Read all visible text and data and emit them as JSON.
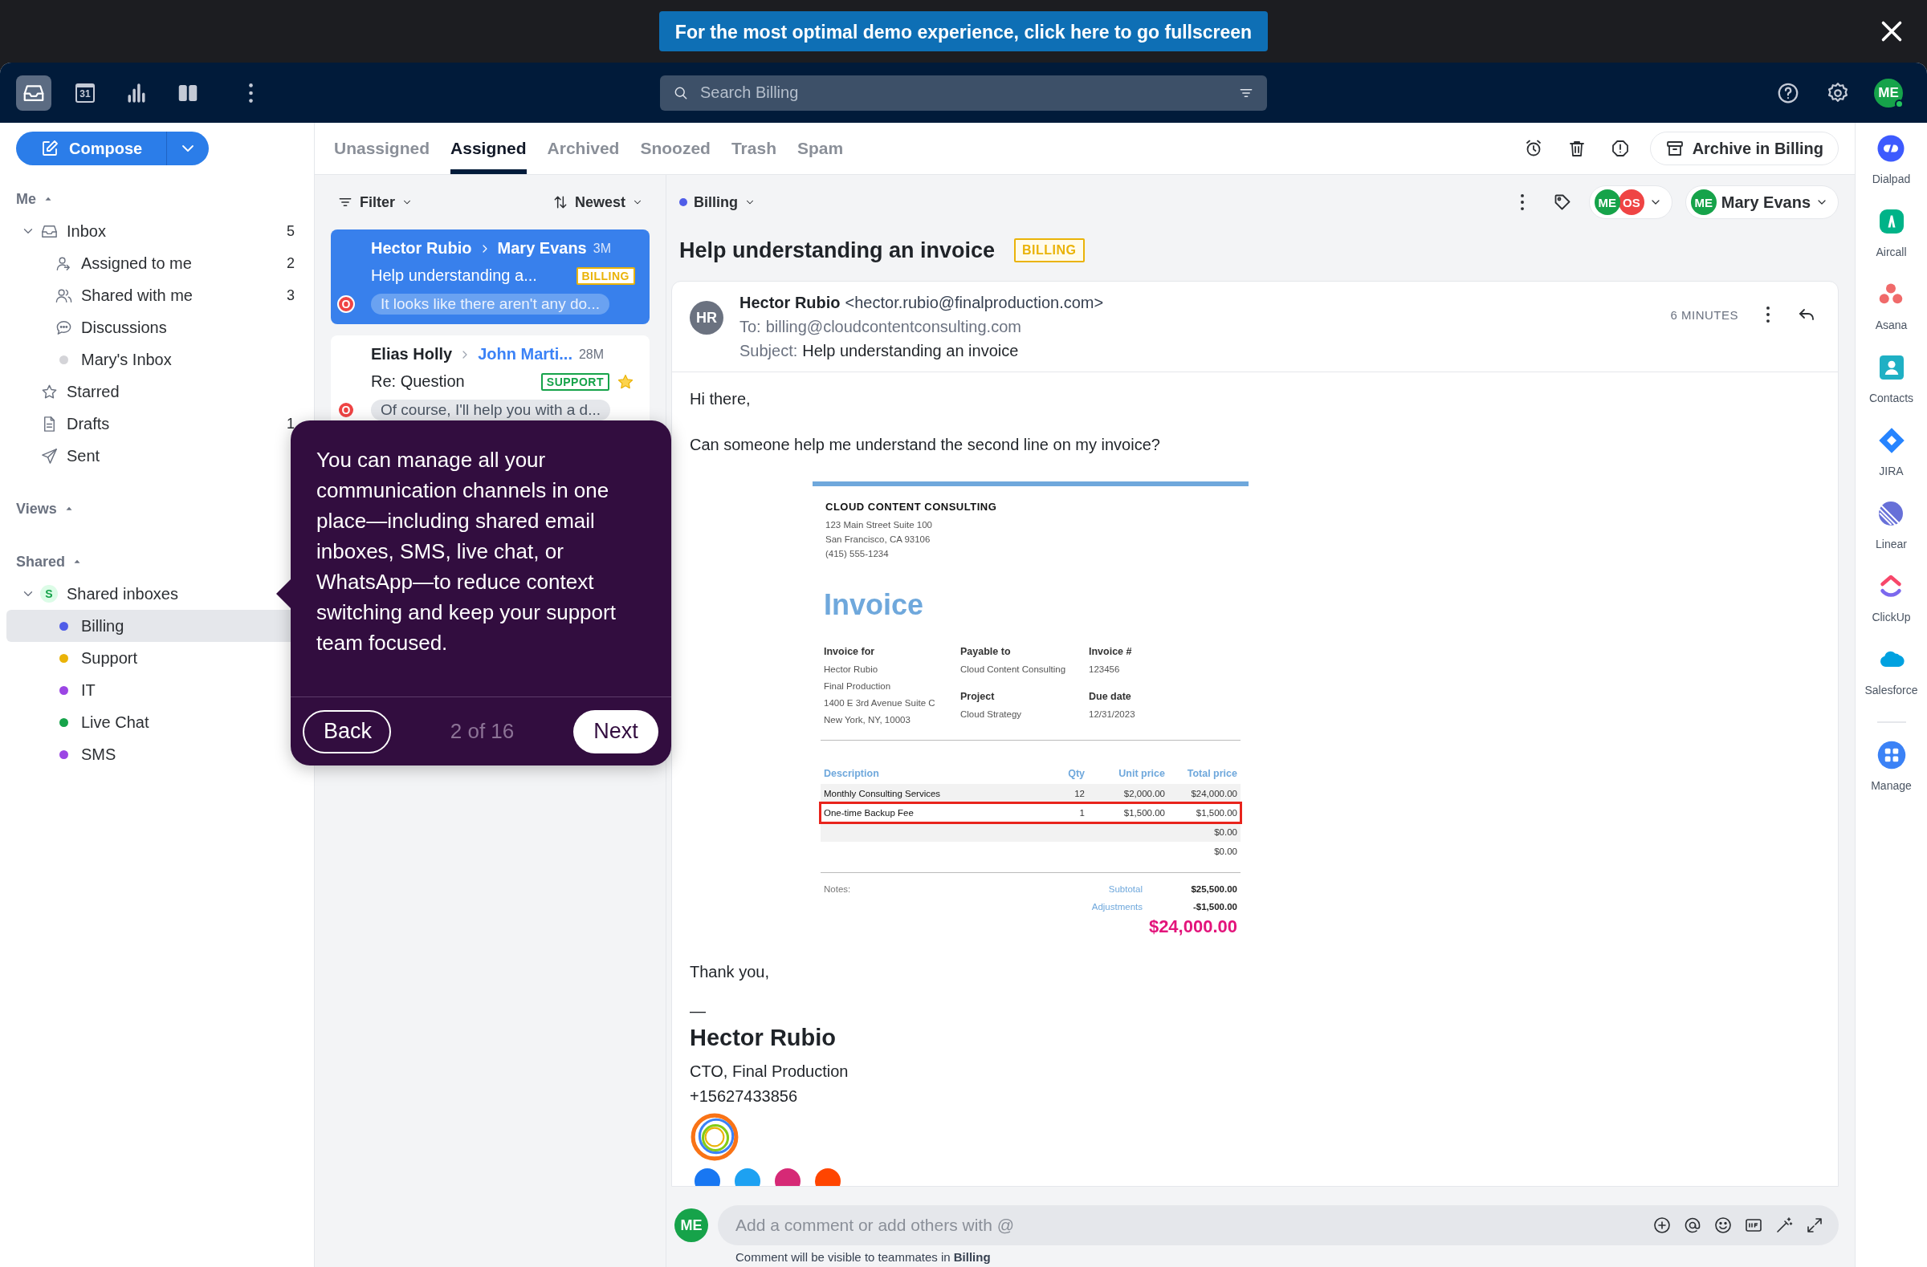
{
  "banner": {
    "text": "For the most optimal demo experience, click here to go fullscreen"
  },
  "app_bar": {
    "nav": [
      {
        "kind": "inbox",
        "selected": true
      },
      {
        "kind": "calendar",
        "label": "31",
        "selected": false
      },
      {
        "kind": "analytics",
        "selected": false
      },
      {
        "kind": "split",
        "selected": false
      },
      {
        "kind": "more",
        "selected": false
      }
    ],
    "search": {
      "placeholder": "Search Billing"
    },
    "avatar": {
      "initials": "ME",
      "color": "#16a34a"
    }
  },
  "sidebar": {
    "compose": "Compose",
    "sections": [
      {
        "title": "Me",
        "expanded": true,
        "items": [
          {
            "label": "Inbox",
            "kind": "inbox",
            "count": "5",
            "selected": false,
            "expanded": true,
            "children": [
              {
                "label": "Assigned to me",
                "kind": "assigned",
                "count": "2",
                "selected": false
              },
              {
                "label": "Shared with me",
                "kind": "shared",
                "count": "3",
                "selected": false
              },
              {
                "label": "Discussions",
                "kind": "discussions",
                "selected": false
              },
              {
                "label": "Mary's Inbox",
                "kind": "dot",
                "color": "#d4d4d8",
                "selected": false
              }
            ]
          },
          {
            "label": "Starred",
            "kind": "star",
            "selected": false
          },
          {
            "label": "Drafts",
            "kind": "draft",
            "count": "1",
            "selected": false
          },
          {
            "label": "Sent",
            "kind": "sent",
            "selected": false
          }
        ]
      },
      {
        "title": "Views",
        "expanded": true
      },
      {
        "title": "Shared",
        "expanded": true,
        "items": [
          {
            "label": "Shared inboxes",
            "kind": "team",
            "badge": "S",
            "selected": false,
            "expanded": true,
            "children": [
              {
                "label": "Billing",
                "kind": "dot",
                "color": "#4f5de8",
                "selected": true
              },
              {
                "label": "Support",
                "kind": "dot",
                "color": "#eab308",
                "selected": false
              },
              {
                "label": "IT",
                "kind": "dot",
                "color": "#9b45e4",
                "selected": false
              },
              {
                "label": "Live Chat",
                "kind": "dot",
                "color": "#16a34a",
                "selected": false
              },
              {
                "label": "SMS",
                "kind": "dot",
                "color": "#9b45e4",
                "selected": false
              }
            ]
          }
        ]
      }
    ]
  },
  "tabs": [
    {
      "label": "Unassigned",
      "selected": false
    },
    {
      "label": "Assigned",
      "selected": true
    },
    {
      "label": "Archived",
      "selected": false
    },
    {
      "label": "Snoozed",
      "selected": false
    },
    {
      "label": "Trash",
      "selected": false
    },
    {
      "label": "Spam",
      "selected": false
    }
  ],
  "toolbar": {
    "archive_button": "Archive in Billing"
  },
  "list": {
    "filter": "Filter",
    "sort": "Newest",
    "conversations": [
      {
        "from": "Hector Rubio",
        "to": "Mary Evans",
        "time": "3M",
        "subject": "Help understanding a...",
        "tag": "BILLING",
        "color": "#eab308",
        "badge": "O",
        "preview": "It looks like there aren't any do...",
        "selected": true,
        "starred": false
      },
      {
        "from": "Elias Holly",
        "to": "John Marti...",
        "time": "28M",
        "subject": "Re: Question",
        "tag": "SUPPORT",
        "color": "#16a34a",
        "badge": "O",
        "preview": "Of course, I'll help you with a d...",
        "selected": false,
        "starred": true
      }
    ]
  },
  "conversation": {
    "inbox": {
      "label": "Billing",
      "color": "#4f5de8"
    },
    "participants": [
      {
        "initials": "ME",
        "color": "#16a34a"
      },
      {
        "initials": "OS",
        "color": "#ef4444"
      }
    ],
    "assignee": {
      "initials": "ME",
      "name": "Mary Evans",
      "color": "#16a34a"
    },
    "title": "Help understanding an invoice",
    "tag": "BILLING",
    "message": {
      "avatar": "HR",
      "sender": "Hector Rubio",
      "address": "<hector.rubio@finalproduction.com>",
      "to_label": "To:",
      "to": "billing@cloudcontentconsulting.com",
      "subject_label": "Subject:",
      "subject": "Help understanding an invoice",
      "time": "6 MINUTES",
      "greeting": "Hi there,",
      "question": "Can someone help me understand the second line on my invoice?",
      "invoice": {
        "company": "CLOUD CONTENT CONSULTING",
        "address": [
          "123 Main Street Suite 100",
          "San Francisco, CA 93106",
          "(415) 555-1234"
        ],
        "title": "Invoice",
        "fields": [
          {
            "label": "Invoice for",
            "lines": [
              "Hector Rubio",
              "Final Production",
              "1400 E 3rd Avenue Suite C",
              "New York, NY, 10003"
            ]
          },
          {
            "label": "Payable to",
            "lines": [
              "Cloud Content Consulting"
            ]
          },
          {
            "label": "Invoice #",
            "lines": [
              "123456"
            ]
          },
          {
            "label": "Project",
            "lines": [
              "Cloud Strategy"
            ]
          },
          {
            "label": "Due date",
            "lines": [
              "12/31/2023"
            ]
          }
        ],
        "columns": [
          "Description",
          "Qty",
          "Unit price",
          "Total price"
        ],
        "rows": [
          {
            "description": "Monthly Consulting Services",
            "qty": "12",
            "unit_price": "$2,000.00",
            "total": "$24,000.00",
            "highlighted": false
          },
          {
            "description": "One-time Backup Fee",
            "qty": "1",
            "unit_price": "$1,500.00",
            "total": "$1,500.00",
            "highlighted": true
          },
          {
            "total": "$0.00",
            "highlighted": false
          },
          {
            "total": "$0.00",
            "highlighted": false
          }
        ],
        "notes": "Notes:",
        "summary": [
          {
            "label": "Subtotal",
            "value": "$25,500.00"
          },
          {
            "label": "Adjustments",
            "value": "-$1,500.00"
          }
        ],
        "grand_total": "$24,000.00"
      },
      "closing": "Thank you,",
      "signature": {
        "dash": "—",
        "name": "Hector Rubio",
        "title": "CTO, Final Production",
        "phone": "+15627433856"
      }
    }
  },
  "comment": {
    "avatar": "ME",
    "placeholder": "Add a comment or add others with @",
    "note": "Comment will be visible to teammates in **Billing**"
  },
  "apps": [
    {
      "label": "Dialpad",
      "kind": "dialpad"
    },
    {
      "label": "Aircall",
      "kind": "aircall"
    },
    {
      "label": "Asana",
      "kind": "asana"
    },
    {
      "label": "Contacts",
      "kind": "contacts"
    },
    {
      "label": "JIRA",
      "kind": "jira"
    },
    {
      "label": "Linear",
      "kind": "linear"
    },
    {
      "label": "ClickUp",
      "kind": "clickup"
    },
    {
      "label": "Salesforce",
      "kind": "salesforce"
    },
    {
      "label": "Manage",
      "kind": "manage"
    }
  ],
  "tour": {
    "text": "You can manage all your communication channels in one place—including shared email inboxes, SMS, live chat, or WhatsApp—to reduce context switching and keep your support team focused.",
    "back": "Back",
    "progress": "2 of 16",
    "next": "Next"
  }
}
